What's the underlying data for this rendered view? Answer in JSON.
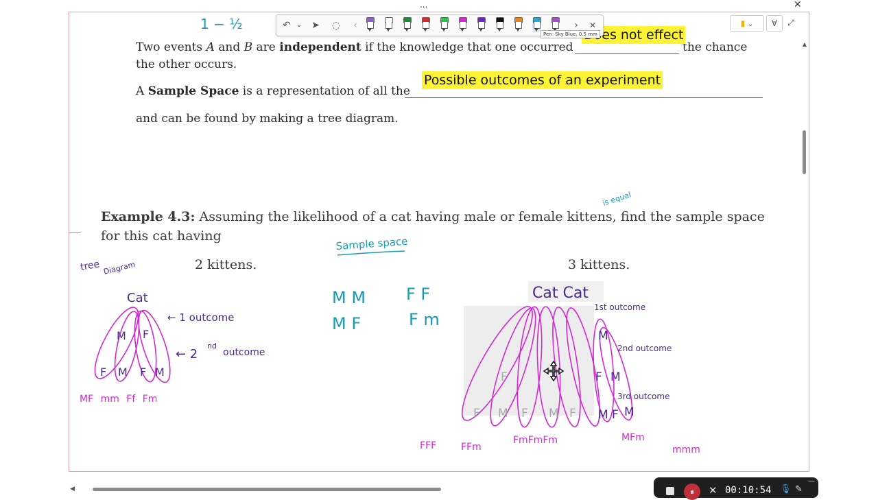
{
  "window": {
    "menu_dots": "...",
    "close_glyph": "✕"
  },
  "toolbar": {
    "undo": "↶",
    "undo_dd": "⌄",
    "select": "➤",
    "lasso": "◌",
    "prev": "‹",
    "next": "›",
    "close": "✕",
    "pens": [
      {
        "color": "#8b5fbf",
        "name": "pen-purple"
      },
      {
        "color": "#ffffff",
        "name": "pen-white"
      },
      {
        "color": "#1e8a3a",
        "name": "pen-green"
      },
      {
        "color": "#d22b2b",
        "name": "pen-red"
      },
      {
        "color": "#2bbf4e",
        "name": "pen-light-green"
      },
      {
        "color": "#d12bd1",
        "name": "pen-magenta"
      },
      {
        "color": "#6a2bbf",
        "name": "pen-violet"
      },
      {
        "color": "#111111",
        "name": "pen-black"
      },
      {
        "color": "#e8821e",
        "name": "pen-orange"
      },
      {
        "color": "#2aa7c9",
        "name": "pen-sky-blue"
      },
      {
        "color": "#a04fc9",
        "name": "pen-lavender"
      }
    ],
    "tooltip": "Pen: Sky Blue, 0.5 mm"
  },
  "right_controls": {
    "sticky": "▮",
    "dropdown": "⌄",
    "filter": "∀",
    "expand": "⤢"
  },
  "document": {
    "p1_pre": "Two events ",
    "p1_a": "A",
    "p1_and": " and ",
    "p1_b": "B",
    "p1_are": " are ",
    "p1_independent": "independent",
    "p1_post": " if the knowledge that one occurred",
    "p1_end": "the chance",
    "p1_line2": "the other occurs.",
    "p1_fill": "Does not effect",
    "p2_a": "A ",
    "p2_bold": "Sample Space",
    "p2_post": " is a representation of all the",
    "p2_fill": "Possible outcomes of an experiment",
    "p3": "and can be found by making a tree diagram.",
    "example_label": "Example 4.3:",
    "example_text": " Assuming the likelihood of a cat having male or female kittens, find the sample space for this cat having",
    "sub1": "2 kittens.",
    "sub2": "3 kittens."
  },
  "ink": {
    "fraction_top": "1 − ½",
    "is_equal": "is equal",
    "sample_space": "Sample space",
    "tree_diagram_1": "tree",
    "tree_diagram_2": "Diagram",
    "cat_left": "Cat",
    "outcome_1": "← 1 outcome",
    "outcome_2_pre": "← 2",
    "outcome_2_sup": "nd",
    "outcome_2_post": "outcome",
    "pairs_row": "MF  mm Ff Fm",
    "ss_r1c1": "M M",
    "ss_r1c2": "F F",
    "ss_r2c1": "M F",
    "ss_r2c2": "F m",
    "cat_right": "Cat Cat",
    "r_outcome_1": "1st outcome",
    "r_outcome_2": "2nd outcome",
    "r_outcome_3": "3rd outcome",
    "bottom_1": "FFF",
    "bottom_2": "FFm",
    "bottom_3": "FmFmFm",
    "bottom_4": "MFm",
    "bottom_5": "mmm"
  },
  "recorder": {
    "pause": "⏸",
    "x": "✕",
    "time": "00:10:54",
    "mic": "🎙",
    "pen": "✎",
    "minimize": "—"
  },
  "colors": {
    "highlight": "#fbf334",
    "ink_teal": "#1a9bb3",
    "ink_magenta": "#d22ad2",
    "ink_purple": "#4a2a8a",
    "border": "#d9a0ad"
  }
}
